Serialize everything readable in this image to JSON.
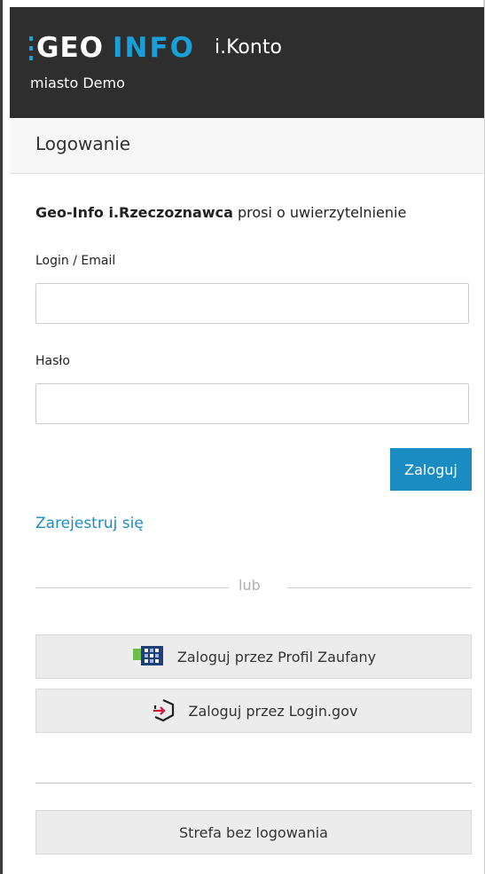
{
  "header": {
    "logo_geo": "GEO",
    "logo_info": "INFO",
    "product": "i.Konto",
    "city": "miasto Demo"
  },
  "panel": {
    "title": "Logowanie"
  },
  "auth_request": {
    "app_name": "Geo-Info i.Rzeczoznawca",
    "text": "prosi o uwierzytelnienie"
  },
  "form": {
    "login_label": "Login / Email",
    "login_value": "",
    "password_label": "Hasło",
    "password_value": "",
    "submit_label": "Zaloguj"
  },
  "register_link": "Zarejestruj się",
  "separator": "lub",
  "alt_logins": {
    "profil_zaufany": {
      "label": "Zaloguj przez Profil Zaufany",
      "icon": "profil-zaufany-icon"
    },
    "login_gov": {
      "label": "Zaloguj przez Login.gov",
      "icon": "login-gov-icon"
    }
  },
  "guest_zone": {
    "label": "Strefa bez logowania"
  },
  "colors": {
    "header_bg": "#2e2e2e",
    "accent": "#1a8cc2",
    "logo_blue": "#1aa0d8",
    "button_gray": "#ececec"
  }
}
